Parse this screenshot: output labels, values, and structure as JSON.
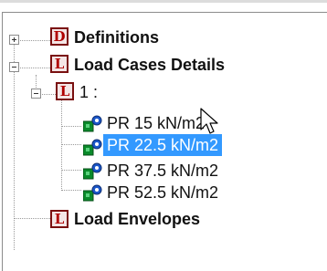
{
  "tree": {
    "definitions": {
      "icon_letter": "D",
      "label": "Definitions"
    },
    "load_cases_details": {
      "icon_letter": "L",
      "label": "Load Cases Details"
    },
    "case_group": {
      "icon_letter": "L",
      "label": "1 :"
    },
    "load_cases": [
      {
        "label": "PR 15 kN/m2",
        "selected": false
      },
      {
        "label": "PR 22.5 kN/m2",
        "selected": true
      },
      {
        "label": "PR 37.5 kN/m2",
        "selected": false
      },
      {
        "label": "PR 52.5 kN/m2",
        "selected": false
      }
    ],
    "load_envelopes": {
      "icon_letter": "L",
      "label": "Load Envelopes"
    }
  },
  "colors": {
    "selection": "#3399ff",
    "icon_red": "#b00000",
    "icon_green": "#0a8a2a",
    "icon_blue": "#1b57c9"
  }
}
